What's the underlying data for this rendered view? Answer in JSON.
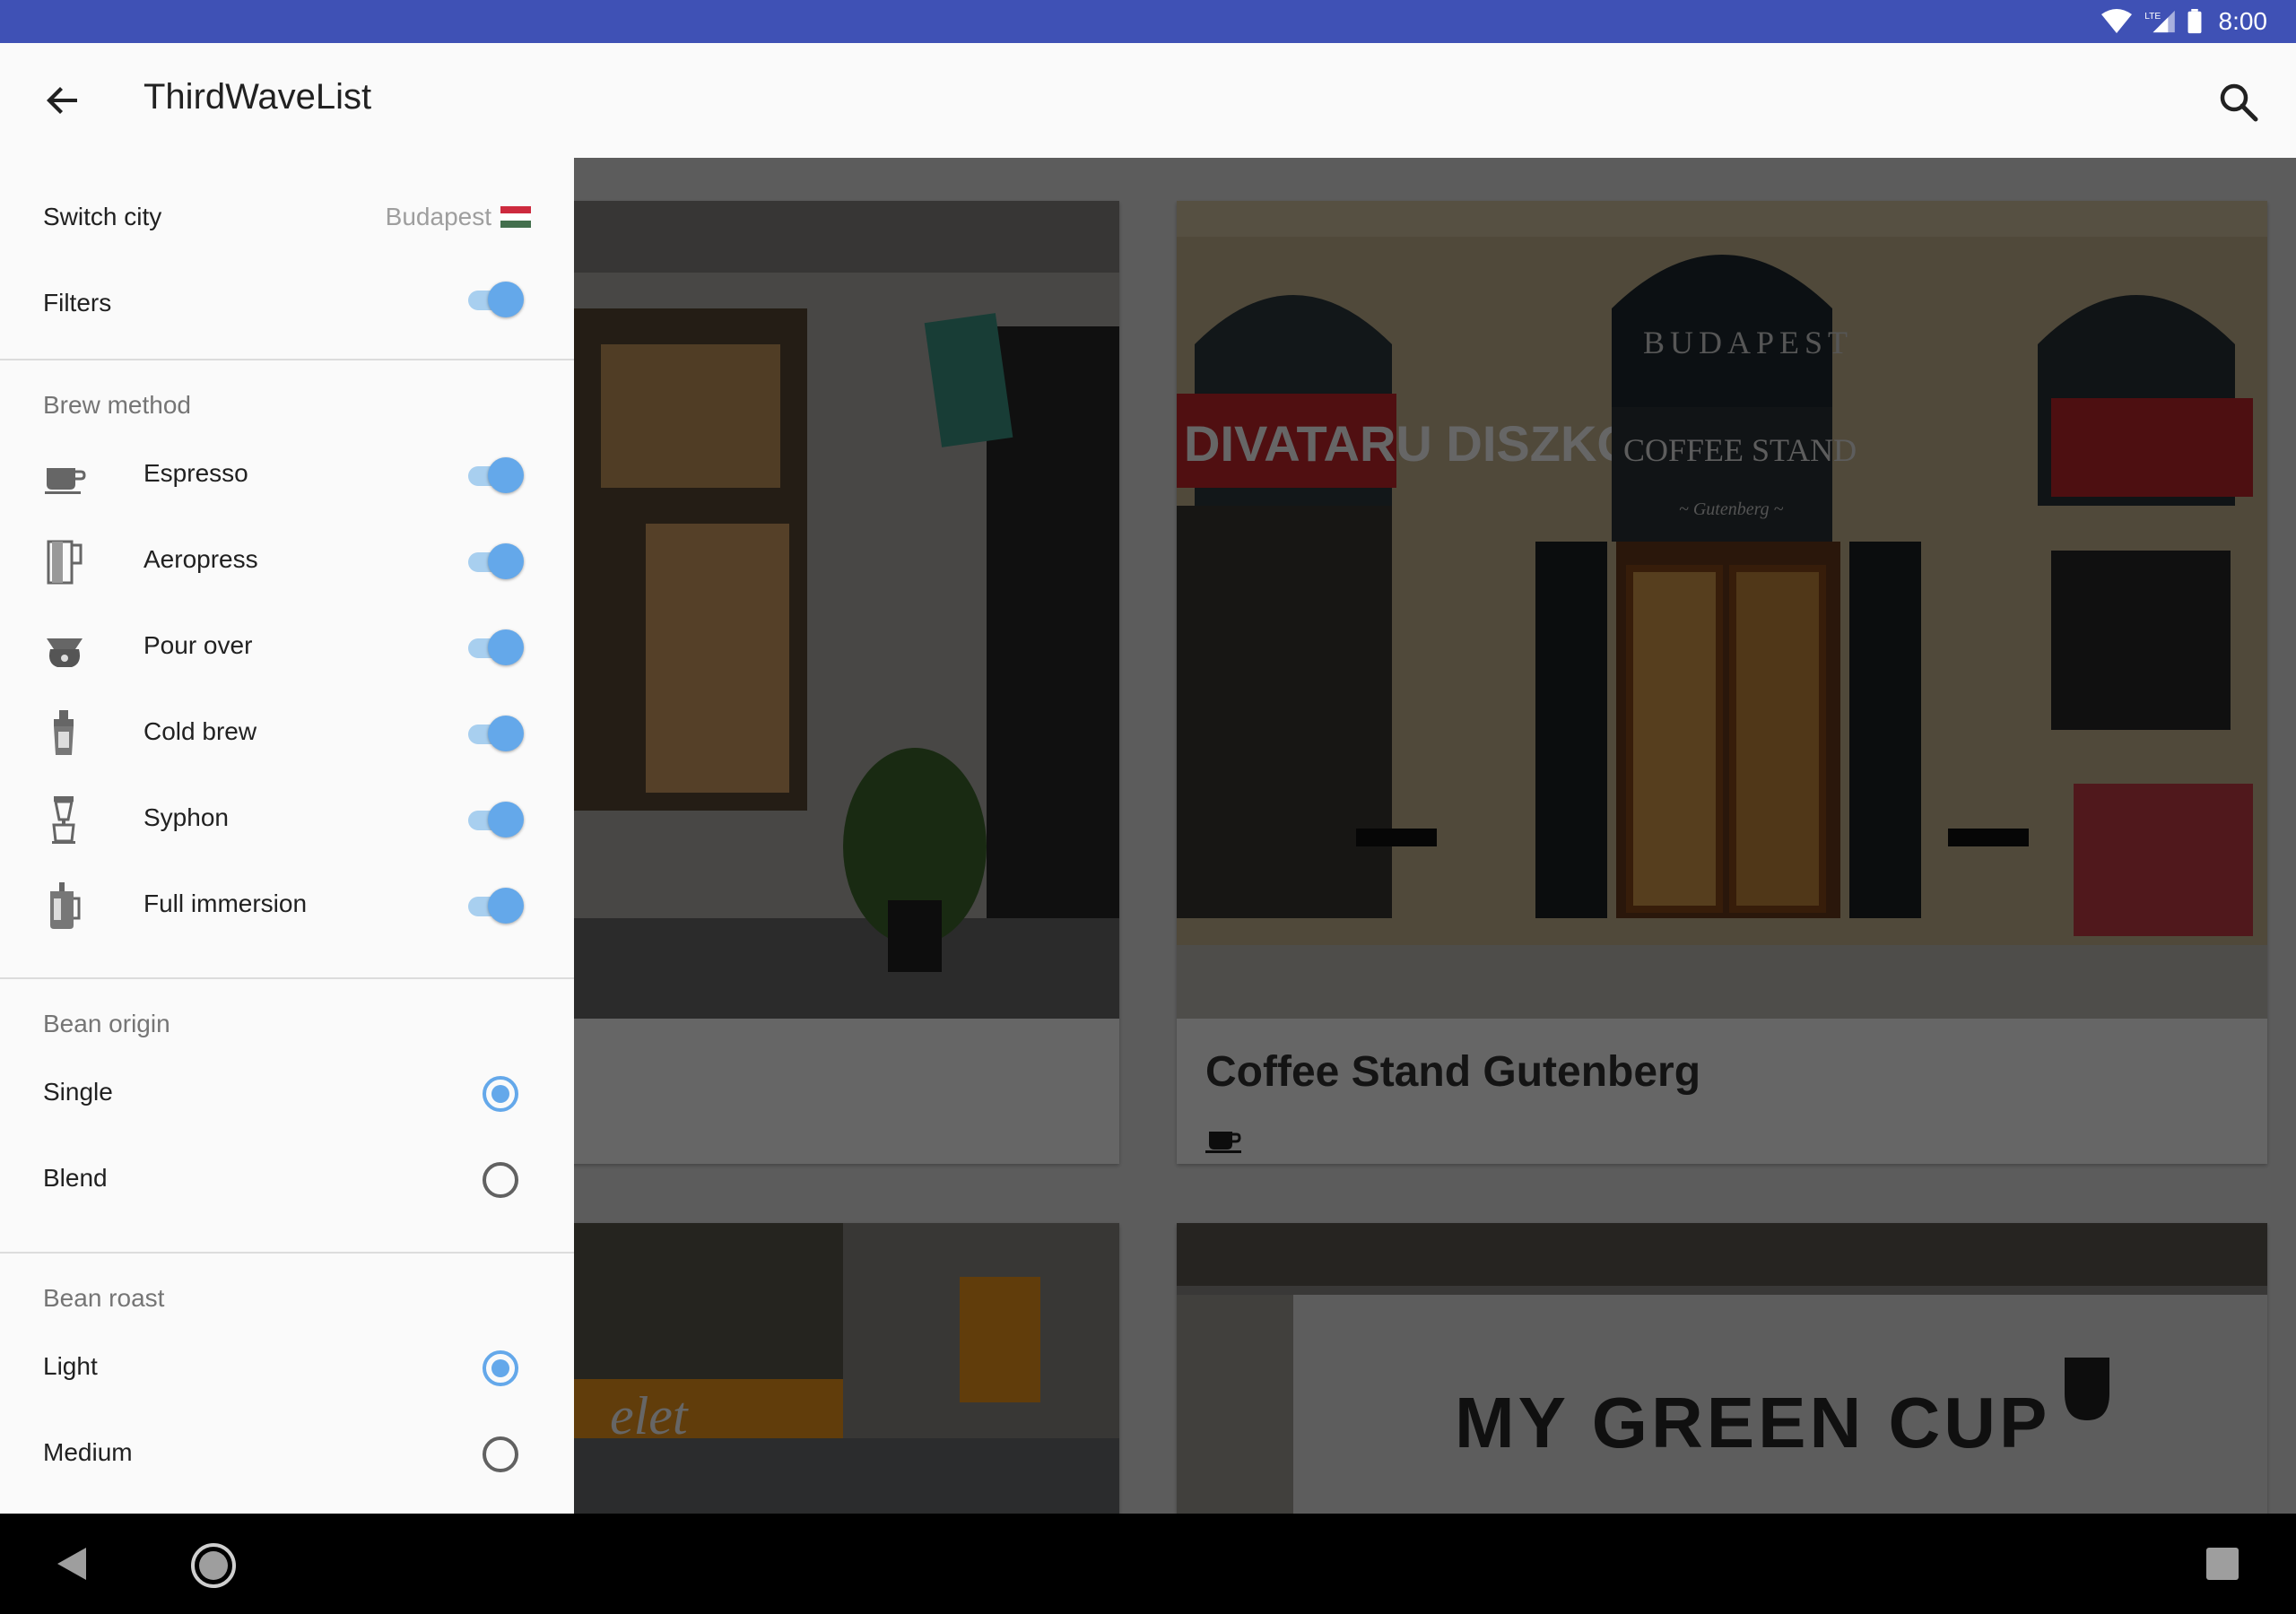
{
  "status_bar": {
    "time": "8:00",
    "network_label": "LTE",
    "icons": [
      "wifi-icon",
      "cell-signal-icon",
      "battery-icon"
    ]
  },
  "app_bar": {
    "title": "ThirdWaveList",
    "back_icon": "arrow-back-icon",
    "search_icon": "search-icon"
  },
  "drawer": {
    "switch_city": {
      "label": "Switch city",
      "value": "Budapest",
      "flag": "hungary-flag"
    },
    "filters": {
      "label": "Filters",
      "enabled": true
    },
    "brew_method": {
      "header": "Brew method",
      "items": [
        {
          "label": "Espresso",
          "icon": "espresso-cup-icon",
          "enabled": true
        },
        {
          "label": "Aeropress",
          "icon": "aeropress-icon",
          "enabled": true
        },
        {
          "label": "Pour over",
          "icon": "pour-over-icon",
          "enabled": true
        },
        {
          "label": "Cold brew",
          "icon": "cold-brew-icon",
          "enabled": true
        },
        {
          "label": "Syphon",
          "icon": "syphon-icon",
          "enabled": true
        },
        {
          "label": "Full immersion",
          "icon": "french-press-icon",
          "enabled": true
        }
      ]
    },
    "bean_origin": {
      "header": "Bean origin",
      "options": [
        {
          "label": "Single",
          "selected": true
        },
        {
          "label": "Blend",
          "selected": false
        }
      ]
    },
    "bean_roast": {
      "header": "Bean roast",
      "options": [
        {
          "label": "Light",
          "selected": true
        },
        {
          "label": "Medium",
          "selected": false
        }
      ]
    }
  },
  "cards": [
    {
      "title": "",
      "photo": "storefront-photo",
      "brew_icon": ""
    },
    {
      "title": "Coffee Stand Gutenberg",
      "photo": "coffee-stand-photo",
      "brew_icon": "espresso-cup-icon",
      "photo_text": {
        "arch": "BUDAPEST",
        "sign": "COFFEE STAND",
        "script": "~ Gutenberg ~",
        "shop": "DIVATARU DISZKONT"
      }
    },
    {
      "title": "",
      "photo": "orange-sign-photo",
      "brew_icon": "",
      "photo_text": {
        "sign": "elet"
      }
    },
    {
      "title": "",
      "photo": "my-green-cup-photo",
      "brew_icon": "",
      "photo_text": {
        "sign": "MY GREEN CUP"
      }
    }
  ],
  "colors": {
    "status_bar": "#3f51b5",
    "accent": "#64a8ea",
    "accent_track": "#a8cfef",
    "drawer_bg": "#fafafa",
    "scrim": "rgba(0,0,0,0.6)"
  }
}
